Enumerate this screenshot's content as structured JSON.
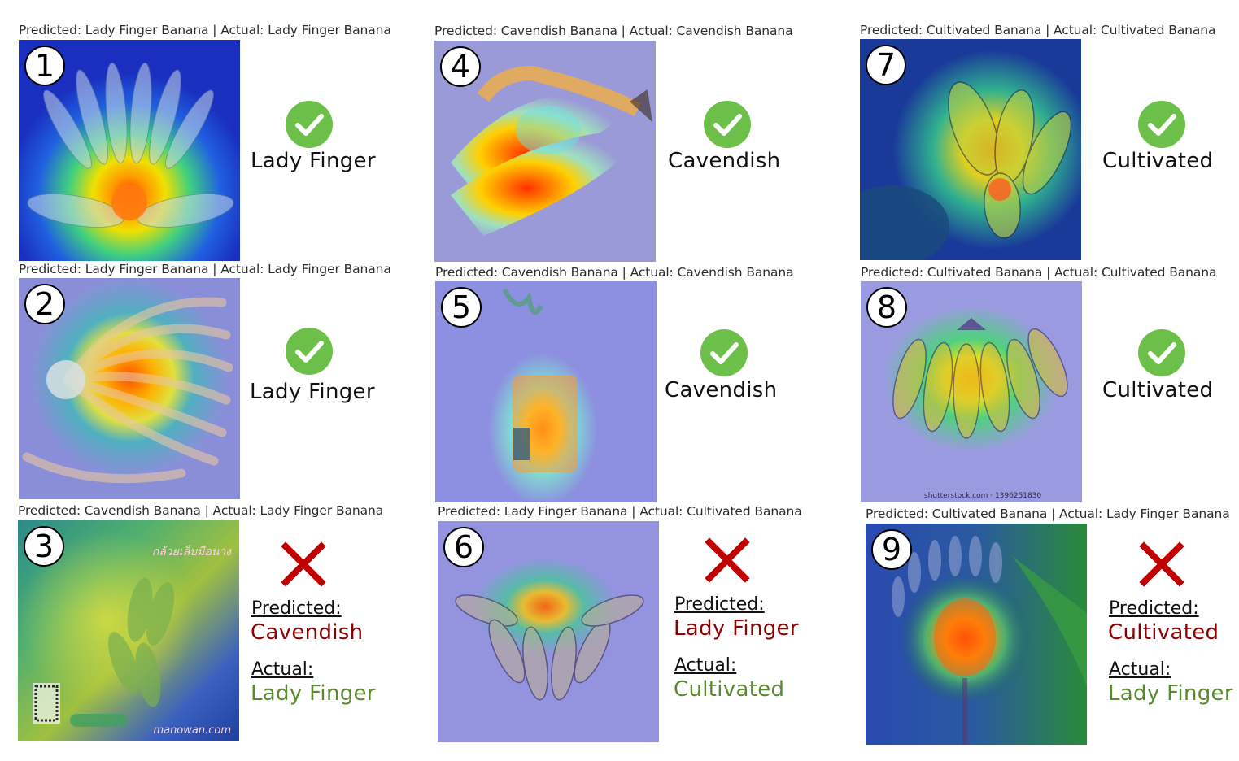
{
  "colors": {
    "correct": "#6cc04a",
    "wrong": "#c00000",
    "predicted_text": "#8b0000",
    "actual_text": "#5a8a2e"
  },
  "labels": {
    "predicted": "Predicted:",
    "actual": "Actual:"
  },
  "cells": [
    {
      "number": "1",
      "caption": "Predicted: Lady Finger Banana | Actual: Lady Finger Banana",
      "correct": true,
      "label": "Lady Finger"
    },
    {
      "number": "2",
      "caption": "Predicted: Lady Finger Banana | Actual: Lady Finger Banana",
      "correct": true,
      "label": "Lady Finger"
    },
    {
      "number": "3",
      "caption": "Predicted: Cavendish Banana | Actual: Lady Finger Banana",
      "correct": false,
      "predicted": "Cavendish",
      "actual": "Lady Finger",
      "watermark_left": "กล้วยเล็บมือนาง",
      "watermark_right": "manowan.com"
    },
    {
      "number": "4",
      "caption": "Predicted: Cavendish Banana | Actual: Cavendish Banana",
      "correct": true,
      "label": "Cavendish"
    },
    {
      "number": "5",
      "caption": "Predicted: Cavendish Banana | Actual: Cavendish Banana",
      "correct": true,
      "label": "Cavendish"
    },
    {
      "number": "6",
      "caption": "Predicted: Lady Finger Banana | Actual: Cultivated Banana",
      "correct": false,
      "predicted": "Lady Finger",
      "actual": "Cultivated"
    },
    {
      "number": "7",
      "caption": "Predicted: Cultivated Banana | Actual: Cultivated Banana",
      "correct": true,
      "label": "Cultivated"
    },
    {
      "number": "8",
      "caption": "Predicted: Cultivated Banana | Actual: Cultivated Banana",
      "correct": true,
      "label": "Cultivated",
      "watermark": "shutterstock.com · 1396251830"
    },
    {
      "number": "9",
      "caption": "Predicted: Cultivated Banana | Actual: Lady Finger Banana",
      "correct": false,
      "predicted": "Cultivated",
      "actual": "Lady Finger"
    }
  ]
}
